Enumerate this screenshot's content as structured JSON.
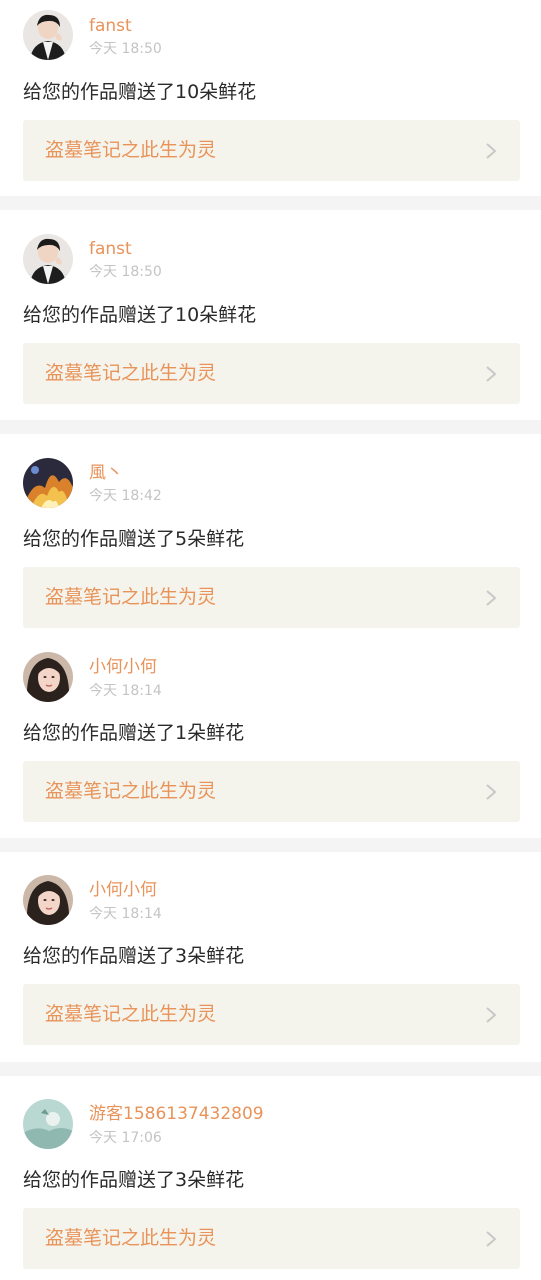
{
  "notifications": [
    {
      "username": "fanst",
      "time": "今天 18:50",
      "message": "给您的作品赠送了10朵鲜花",
      "work_title": "盗墓笔记之此生为灵",
      "avatar": "avatar-photo-dark-hair-white-shirt"
    },
    {
      "username": "fanst",
      "time": "今天 18:50",
      "message": "给您的作品赠送了10朵鲜花",
      "work_title": "盗墓笔记之此生为灵",
      "avatar": "avatar-photo-dark-hair-white-shirt"
    },
    {
      "username": "風丶",
      "time": "今天 18:42",
      "message": "给您的作品赠送了5朵鲜花",
      "work_title": "盗墓笔记之此生为灵",
      "avatar": "avatar-fire-graphic"
    },
    {
      "username": "小何小何",
      "time": "今天 18:14",
      "message": "给您的作品赠送了1朵鲜花",
      "work_title": "盗墓笔记之此生为灵",
      "avatar": "avatar-photo-girl"
    },
    {
      "username": "小何小何",
      "time": "今天 18:14",
      "message": "给您的作品赠送了3朵鲜花",
      "work_title": "盗墓笔记之此生为灵",
      "avatar": "avatar-photo-girl"
    },
    {
      "username": "游客1586137432809",
      "time": "今天 17:06",
      "message": "给您的作品赠送了3朵鲜花",
      "work_title": "盗墓笔记之此生为灵",
      "avatar": "avatar-landscape-teal"
    }
  ],
  "colors": {
    "accent": "#e8935a",
    "timestamp": "#c4c4c4",
    "message": "#2a2a2a",
    "link_background": "#f5f4ec",
    "chevron": "#c8c8c8",
    "separator": "#f4f4f4"
  },
  "icons": {
    "chevron": "chevron-right-icon"
  }
}
